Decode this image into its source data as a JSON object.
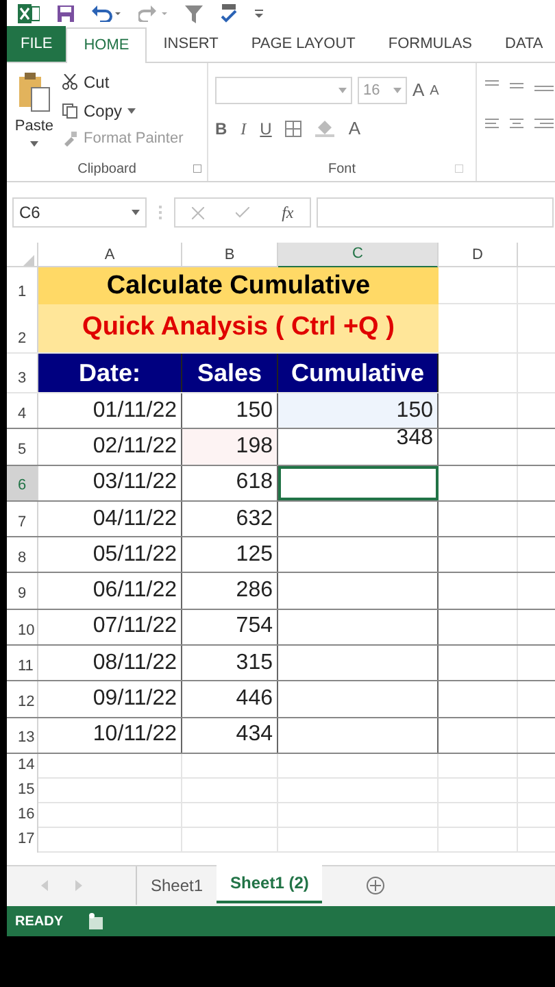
{
  "ribbon_tabs": [
    {
      "label": "FILE",
      "kind": "file",
      "selected": false
    },
    {
      "label": "HOME",
      "kind": "tab",
      "selected": true
    },
    {
      "label": "INSERT",
      "kind": "tab",
      "selected": false
    },
    {
      "label": "PAGE LAYOUT",
      "kind": "tab",
      "selected": false
    },
    {
      "label": "FORMULAS",
      "kind": "tab",
      "selected": false
    },
    {
      "label": "DATA",
      "kind": "tab",
      "selected": false
    }
  ],
  "clipboard": {
    "paste": "Paste",
    "cut": "Cut",
    "copy": "Copy",
    "format_painter": "Format Painter",
    "label": "Clipboard"
  },
  "font": {
    "size": "16",
    "bold": "B",
    "italic": "I",
    "underline": "U",
    "grow": "A",
    "shrink": "A",
    "font_color": "A",
    "label": "Font"
  },
  "name_box": "C6",
  "fx": "fx",
  "columns": [
    {
      "label": "A",
      "selected": false
    },
    {
      "label": "B",
      "selected": false
    },
    {
      "label": "C",
      "selected": true
    },
    {
      "label": "D",
      "selected": false
    }
  ],
  "title": "Calculate Cumulative",
  "subtitle": "Quick Analysis ( Ctrl +Q )",
  "headers": [
    "Date:",
    "Sales",
    "Cumulative"
  ],
  "rows": [
    {
      "date": "01/11/22",
      "sales": "150",
      "cumulative": "150",
      "selected": false
    },
    {
      "date": "02/11/22",
      "sales": "198",
      "cumulative": "348",
      "selected": false
    },
    {
      "date": "03/11/22",
      "sales": "618",
      "selected": true
    },
    {
      "date": "04/11/22",
      "sales": "632",
      "selected": false
    },
    {
      "date": "05/11/22",
      "sales": "125",
      "selected": false
    },
    {
      "date": "06/11/22",
      "sales": "286",
      "selected": false
    },
    {
      "date": "07/11/22",
      "sales": "754",
      "selected": false
    },
    {
      "date": "08/11/22",
      "sales": "315",
      "selected": false
    },
    {
      "date": "09/11/22",
      "sales": "446",
      "selected": false
    },
    {
      "date": "10/11/22",
      "sales": "434",
      "selected": false
    }
  ],
  "row_numbers": [
    "1",
    "2",
    "3",
    "4",
    "5",
    "6",
    "7",
    "8",
    "9",
    "10",
    "11",
    "12",
    "13",
    "14",
    "15",
    "16",
    "17"
  ],
  "sheet_tabs": [
    {
      "label": "Sheet1",
      "selected": false
    },
    {
      "label": "Sheet1 (2)",
      "selected": true
    }
  ],
  "status": "READY"
}
